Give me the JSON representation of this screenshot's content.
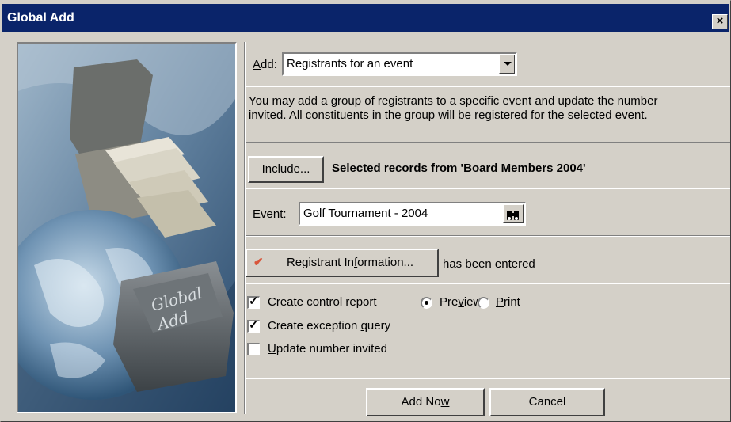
{
  "window": {
    "title": "Global Add",
    "close_glyph": "×"
  },
  "image": {
    "caption_line1": "Global",
    "caption_line2": "Add"
  },
  "add": {
    "label_key": "A",
    "label_rest": "dd:",
    "selected": "Registrants for an event"
  },
  "description": {
    "line1": "You may add a group of registrants to a specific event and update the number",
    "line2": "invited.  All constituents in the group will be registered for the selected event."
  },
  "include": {
    "button_label": "Include...",
    "selection_text": "Selected records from 'Board Members 2004'"
  },
  "event": {
    "label_key": "E",
    "label_rest": "vent:",
    "value": "Golf Tournament - 2004",
    "lookup_icon": "binoculars-icon"
  },
  "registrant": {
    "button_pre": "Registrant In",
    "button_key": "f",
    "button_post": "ormation...",
    "status": "has been entered",
    "check_color": "#d8553a"
  },
  "options": {
    "control_report": {
      "label": "Create control report",
      "checked": true
    },
    "preview": {
      "pre": "Pre",
      "key": "v",
      "post": "iew",
      "selected": true
    },
    "print": {
      "key": "P",
      "post": "rint",
      "selected": false
    },
    "exception_query": {
      "pre": "Create exception ",
      "key": "q",
      "post": "uery",
      "checked": true
    },
    "update_invited": {
      "key": "U",
      "post": "pdate number invited",
      "checked": false
    }
  },
  "buttons": {
    "add_now": {
      "pre": "Add No",
      "key": "w"
    },
    "cancel": {
      "label": "Cancel"
    }
  },
  "colors": {
    "title_bar": "#0a246a",
    "face": "#d4d0c8"
  }
}
